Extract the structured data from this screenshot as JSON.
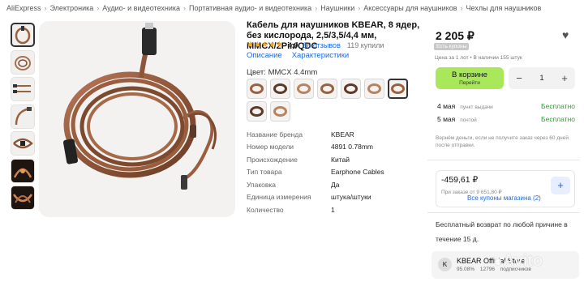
{
  "breadcrumb": [
    "AliExpress",
    "Электроника",
    "Аудио- и видеотехника",
    "Портативная аудио- и видеотехника",
    "Наушники",
    "Аксессуары для наушников",
    "Чехлы для наушников"
  ],
  "product": {
    "title": "Кабель для наушников KBEAR, 8 ядер, без кислорода, 2,5/3,5/4,4 мм, MMCX/2Pin/QDC",
    "stars": "★★★★★",
    "rating": "4,9",
    "reviews": "86 отзывов",
    "sold": "119 купили",
    "tabs": [
      "Описание",
      "Характеристики"
    ],
    "color_label": "Цвет: MMCX 4.4mm",
    "swatch_count": 9,
    "selected_swatch": 6
  },
  "specs": [
    {
      "key": "Название бренда",
      "value": "KBEAR"
    },
    {
      "key": "Номер модели",
      "value": "4891 0.78mm"
    },
    {
      "key": "Происхождение",
      "value": "Китай"
    },
    {
      "key": "Тип товара",
      "value": "Earphone Cables"
    },
    {
      "key": "Упаковка",
      "value": "Да"
    },
    {
      "key": "Единица измерения",
      "value": "штука/штуки"
    },
    {
      "key": "Количество",
      "value": "1"
    }
  ],
  "buy": {
    "price": "2 205 ₽",
    "coupon_badge": "Есть купоны",
    "stock": "Цена за 1 лот • В наличии 155 штук",
    "cart_label": "В корзине",
    "cart_sub": "Перейти",
    "qty_minus": "−",
    "qty": "1",
    "qty_plus": "+",
    "delivery": [
      {
        "date": "4 мая",
        "method": "пункт выдачи",
        "price": "Бесплатно"
      },
      {
        "date": "5 мая",
        "method": "почтой",
        "price": "Бесплатно"
      }
    ],
    "note": "Вернём деньги, если не получите заказ через 60 дней после отправки."
  },
  "coupon": {
    "amount": "-459,61 ₽",
    "condition": "При заказе от 9 651,80 ₽",
    "plus": "+",
    "all_link": "Все купоны магазина (2)"
  },
  "returns": {
    "text": "Бесплатный возврат по любой причине в течение 15 д."
  },
  "store": {
    "name": "KBEAR Official Store",
    "rating": "95.08%",
    "followers": "12796",
    "extra": "подписчиков",
    "logo": "K"
  },
  "watermark": "Avito",
  "colors": {
    "accent_green": "#a9e85a",
    "link_blue": "#1f6ad9",
    "free_green": "#2e9e3a",
    "cable_copper": "#9c6240"
  }
}
